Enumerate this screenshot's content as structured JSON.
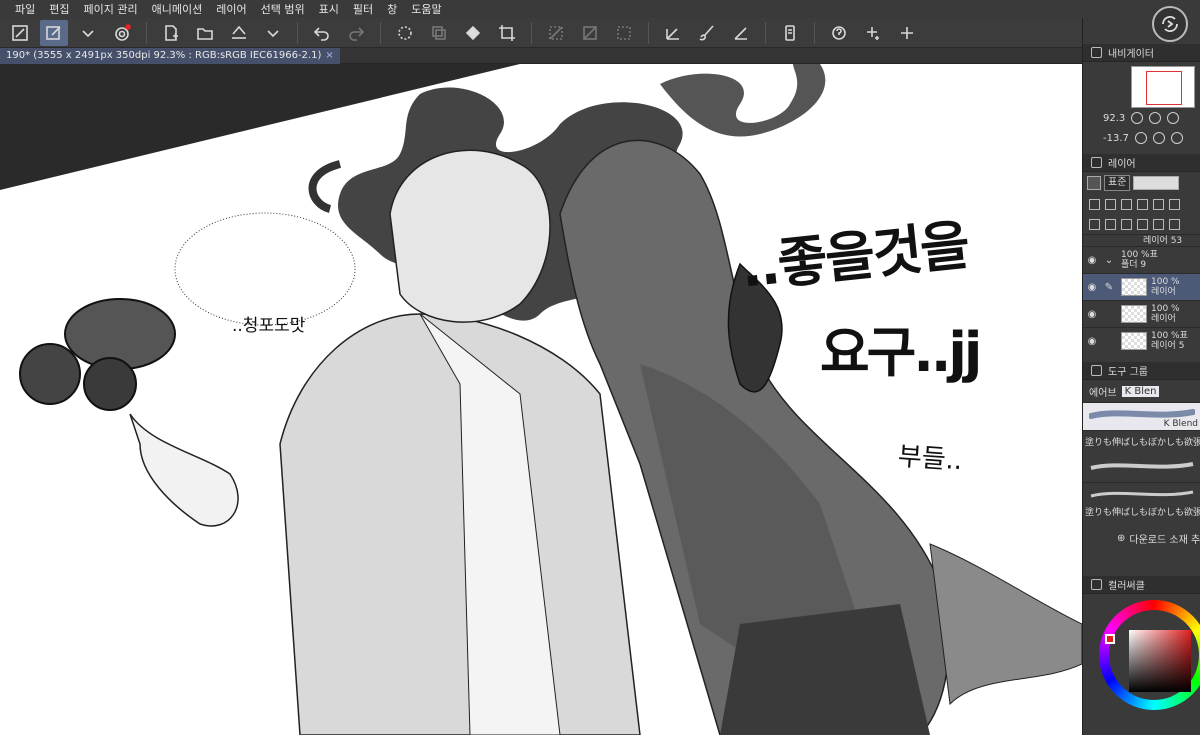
{
  "menu": [
    "파일",
    "편집",
    "페이지 관리",
    "애니메이션",
    "레이어",
    "선택 범위",
    "표시",
    "필터",
    "창",
    "도움말"
  ],
  "document": {
    "tab_label": "190* (3555 x 2491px 350dpi 92.3% : RGB:sRGB IEC61966-2.1)",
    "close_glyph": "×"
  },
  "toolbar_icons": [
    "fit-screen-icon",
    "tool-settings-icon",
    "dropdown-icon",
    "record-icon",
    "new-file-icon",
    "open-folder-icon",
    "save-icon",
    "save-dropdown-icon",
    "undo-icon",
    "redo-icon",
    "loading-icon",
    "layer-copy-icon",
    "fill-icon",
    "crop-icon",
    "transform-icon",
    "deselect-icon",
    "invert-selection-icon",
    "pen-icon",
    "brush-icon",
    "ruler-icon",
    "phone-icon",
    "help-icon",
    "sparkle-icon",
    "sparkle2-icon"
  ],
  "artwork": {
    "speech_bubble": "..청포도맛",
    "sfx_line1": "..좋을것을",
    "sfx_line2": "요구..jj",
    "sfx_line3": "부들.."
  },
  "navigator": {
    "title": "내비게이터",
    "zoom": "92.3",
    "rotation": "-13.7"
  },
  "layers": {
    "title": "레이어",
    "blend_mode": "표준",
    "items": [
      {
        "name": "레이어 53",
        "opacity": "",
        "selected": false
      },
      {
        "name": "폴더 9",
        "opacity": "100 %표",
        "selected": false
      },
      {
        "name": "레이어",
        "opacity": "100 %",
        "selected": true
      },
      {
        "name": "레이어",
        "opacity": "100 %",
        "selected": false
      },
      {
        "name": "레이어 5",
        "opacity": "100 %표",
        "selected": false
      }
    ]
  },
  "tool_group": {
    "title": "도구 그룹",
    "tabs": [
      "에어브",
      "K Blen"
    ],
    "brushes": [
      {
        "name": "K Blend",
        "selected": true
      },
      {
        "name": "塗りも伸ばしもぼかしも欲張",
        "selected": false
      },
      {
        "name": "塗りも伸ばしもぼかしも欲張",
        "selected": false
      }
    ],
    "download_label": "다운로드 소재 추가"
  },
  "color": {
    "title": "컬러써클",
    "hue": "#e02020"
  }
}
